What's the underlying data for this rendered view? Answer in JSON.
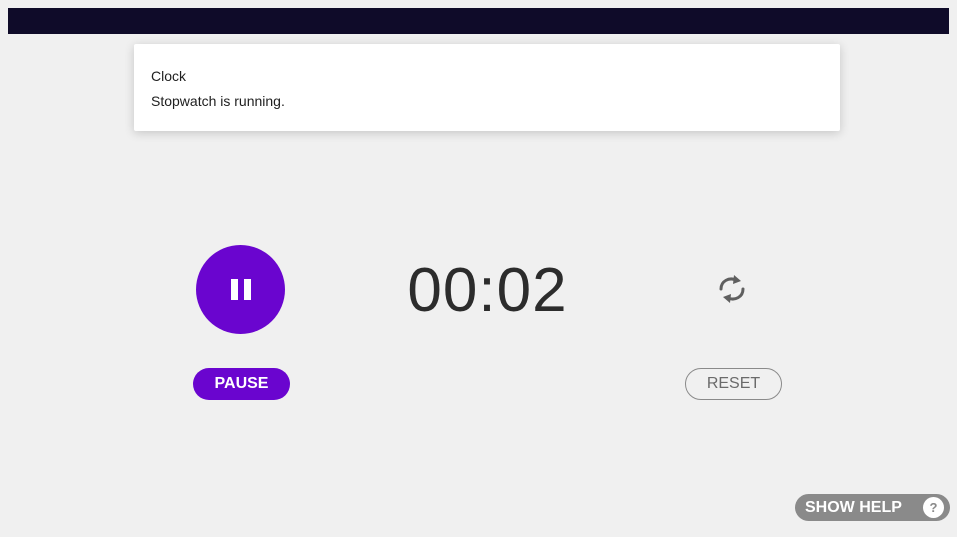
{
  "notification": {
    "title": "Clock",
    "text": "Stopwatch is running."
  },
  "stopwatch": {
    "time": "00:02",
    "pause_label": "PAUSE",
    "reset_label": "RESET"
  },
  "help": {
    "label": "SHOW HELP",
    "icon_glyph": "?"
  },
  "colors": {
    "accent": "#6a05cf",
    "background": "#f0f0f0",
    "status_bar": "#0f0b29",
    "help_button": "#8a8a8a"
  },
  "icons": {
    "play_pause": "pause-icon",
    "reset": "reset-icon",
    "help": "question-icon"
  }
}
